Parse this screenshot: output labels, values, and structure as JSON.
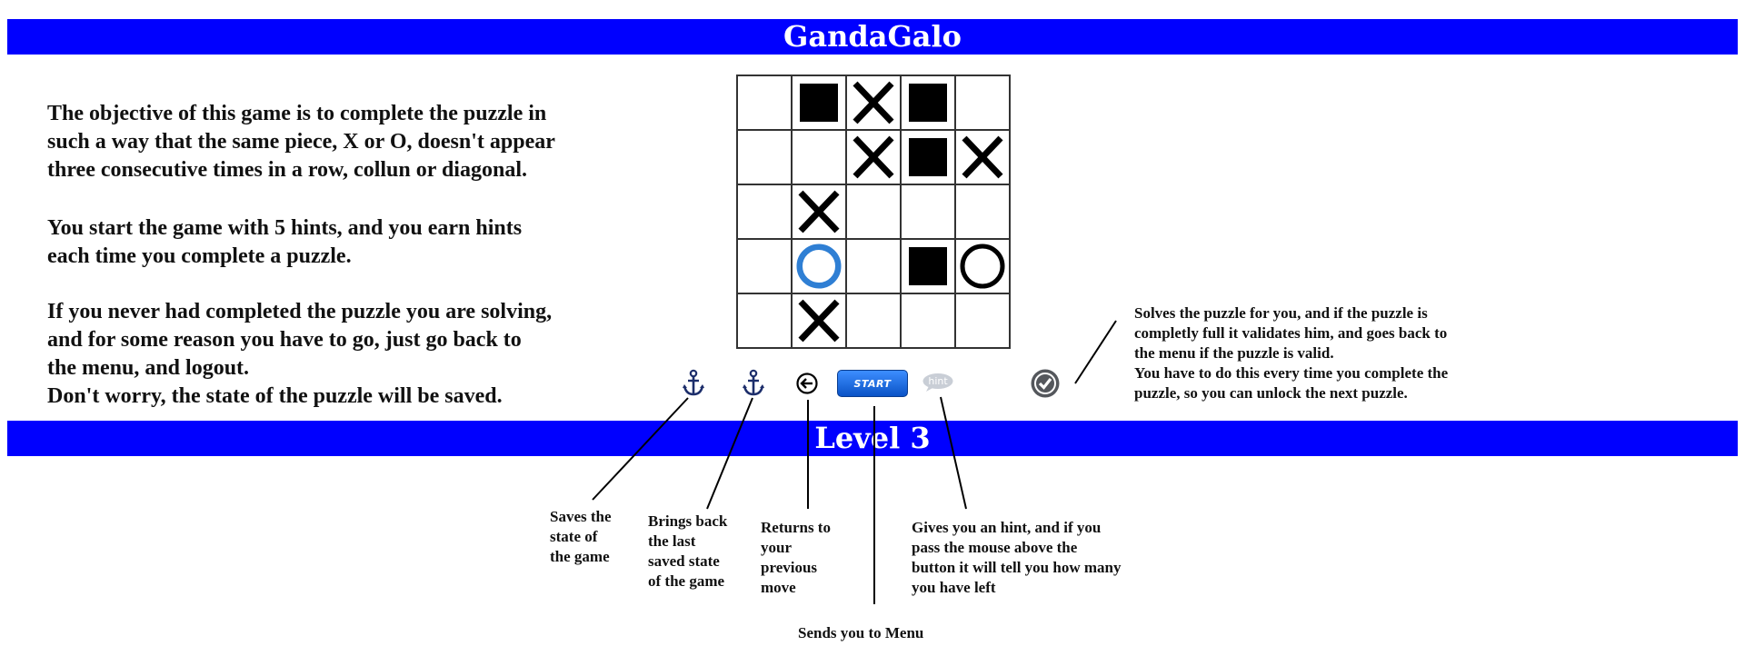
{
  "header": {
    "title": "GandaGalo"
  },
  "instructions": [
    [
      "The objective of this game is to complete the puzzle in",
      "such a way that the same piece, X or O, doesn't appear",
      "three consecutive times in a row, collun or diagonal."
    ],
    [
      "You start the game with 5 hints, and you earn hints",
      "each time you complete a puzzle."
    ],
    [
      "If you never had completed the puzzle you are solving,",
      "and for some reason you have to go, just go back to",
      "the menu, and logout.",
      "Don't worry, the state of the puzzle will be saved."
    ]
  ],
  "board": {
    "rows": [
      [
        "empty",
        "block",
        "X",
        "block",
        "empty"
      ],
      [
        "empty",
        "empty",
        "X",
        "block",
        "X"
      ],
      [
        "empty",
        "X",
        "empty",
        "empty",
        "empty"
      ],
      [
        "empty",
        "O-selected",
        "empty",
        "block",
        "O"
      ],
      [
        "empty",
        "X",
        "empty",
        "empty",
        "empty"
      ]
    ]
  },
  "toolbar": {
    "save_icon": "anchor-icon",
    "load_icon": "anchor-icon",
    "undo_icon": "back-arrow-icon",
    "start_label": "START",
    "hint_label": "hint",
    "solve_icon": "check-circle-icon"
  },
  "level": {
    "label": "Level 3"
  },
  "annotations": {
    "save": [
      "Saves the",
      "state of",
      "the game"
    ],
    "load": [
      "Brings back",
      "the last",
      "saved state",
      "of the game"
    ],
    "undo": [
      "Returns to",
      "your",
      "previous",
      "move"
    ],
    "hint": [
      "Gives you an hint, and if you",
      "pass the mouse above the",
      "button it will tell you how many",
      "you have left"
    ],
    "menu": [
      "Sends you to Menu"
    ],
    "solve": [
      "Solves the puzzle for you, and if the puzzle is",
      "completly full it validates him, and goes back to",
      "the menu if the puzzle is valid.",
      "You have to do this every time you complete the",
      "puzzle, so you can unlock the next puzzle."
    ]
  },
  "colors": {
    "banner": "#0000ff",
    "accent_ring": "#2f7fd4",
    "start_button": "#1565e0"
  }
}
